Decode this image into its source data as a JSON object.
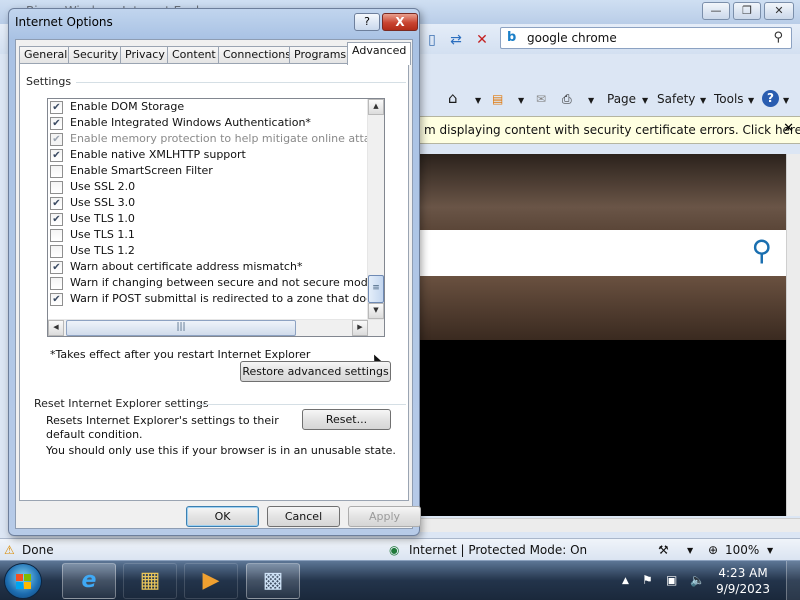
{
  "browser": {
    "window_title": "Bing - Windows Internet Explorer",
    "search": {
      "engine_icon": "bing-icon",
      "value": "google chrome"
    },
    "command_bar": {
      "page_label": "Page",
      "safety_label": "Safety",
      "tools_label": "Tools"
    },
    "info_bar": {
      "text": "m displaying content with security certificate errors. Click here for"
    },
    "status": {
      "done": "Done",
      "zone": "Internet | Protected Mode: On",
      "zoom": "100%"
    }
  },
  "dialog": {
    "title": "Internet Options",
    "help_label": "?",
    "close_label": "X",
    "tabs": [
      {
        "label": "General"
      },
      {
        "label": "Security"
      },
      {
        "label": "Privacy"
      },
      {
        "label": "Content"
      },
      {
        "label": "Connections"
      },
      {
        "label": "Programs"
      },
      {
        "label": "Advanced",
        "active": true
      }
    ],
    "settings_label": "Settings",
    "options": [
      {
        "label": "Enable DOM Storage",
        "checked": true,
        "disabled": false
      },
      {
        "label": "Enable Integrated Windows Authentication*",
        "checked": true,
        "disabled": false
      },
      {
        "label": "Enable memory protection to help mitigate online attacks*",
        "checked": true,
        "disabled": true
      },
      {
        "label": "Enable native XMLHTTP support",
        "checked": true,
        "disabled": false
      },
      {
        "label": "Enable SmartScreen Filter",
        "checked": false,
        "disabled": false
      },
      {
        "label": "Use SSL 2.0",
        "checked": false,
        "disabled": false
      },
      {
        "label": "Use SSL 3.0",
        "checked": true,
        "disabled": false
      },
      {
        "label": "Use TLS 1.0",
        "checked": true,
        "disabled": false
      },
      {
        "label": "Use TLS 1.1",
        "checked": false,
        "disabled": false
      },
      {
        "label": "Use TLS 1.2",
        "checked": false,
        "disabled": false
      },
      {
        "label": "Warn about certificate address mismatch*",
        "checked": true,
        "disabled": false
      },
      {
        "label": "Warn if changing between secure and not secure mode",
        "checked": false,
        "disabled": false
      },
      {
        "label": "Warn if POST submittal is redirected to a zone that does n",
        "checked": true,
        "disabled": false
      }
    ],
    "restart_note": "*Takes effect after you restart Internet Explorer",
    "restore_button": "Restore advanced settings",
    "reset_group_label": "Reset Internet Explorer settings",
    "reset_description": "Resets Internet Explorer's settings to their default condition.",
    "reset_button": "Reset...",
    "reset_warning": "You should only use this if your browser is in an unusable state.",
    "ok_button": "OK",
    "cancel_button": "Cancel",
    "apply_button": "Apply"
  },
  "taskbar": {
    "time": "4:23 AM",
    "date": "9/9/2023"
  }
}
